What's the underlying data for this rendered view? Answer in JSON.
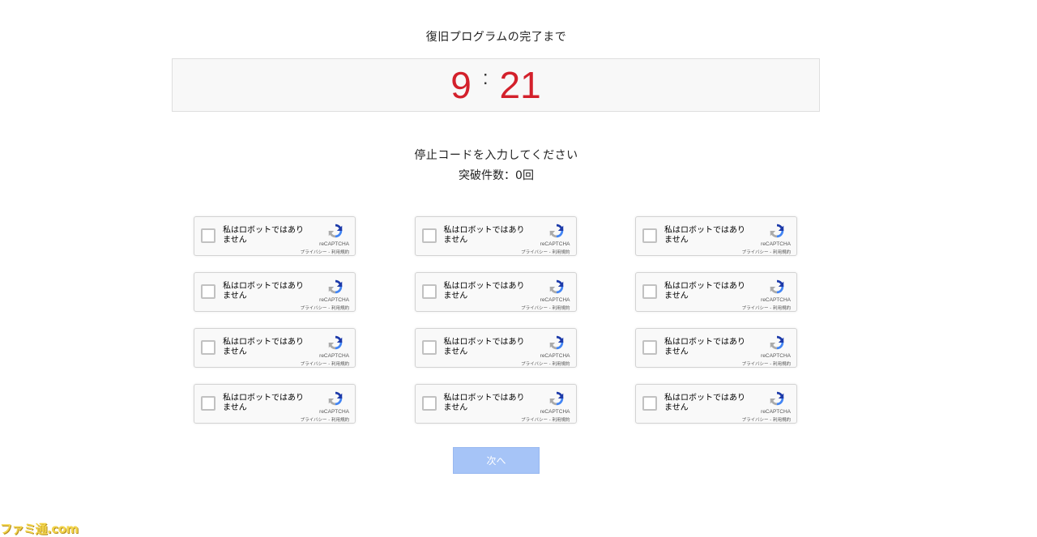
{
  "title": "復旧プログラムの完了まで",
  "timer": {
    "minutes": "9",
    "separator": ":",
    "seconds": "21"
  },
  "instruction": "停止コードを入力してください",
  "breach_count": "突破件数：0回",
  "captcha": {
    "label": "私はロボットではありません",
    "brand": "reCAPTCHA",
    "terms": "プライバシー - 利用規約",
    "count": 12,
    "checked_count": 0
  },
  "next_button": "次へ",
  "watermark": "ファミ通.com",
  "colors": {
    "timer": "#d3202b",
    "button": "#a6c4f7",
    "watermark": "#f3d54b"
  }
}
